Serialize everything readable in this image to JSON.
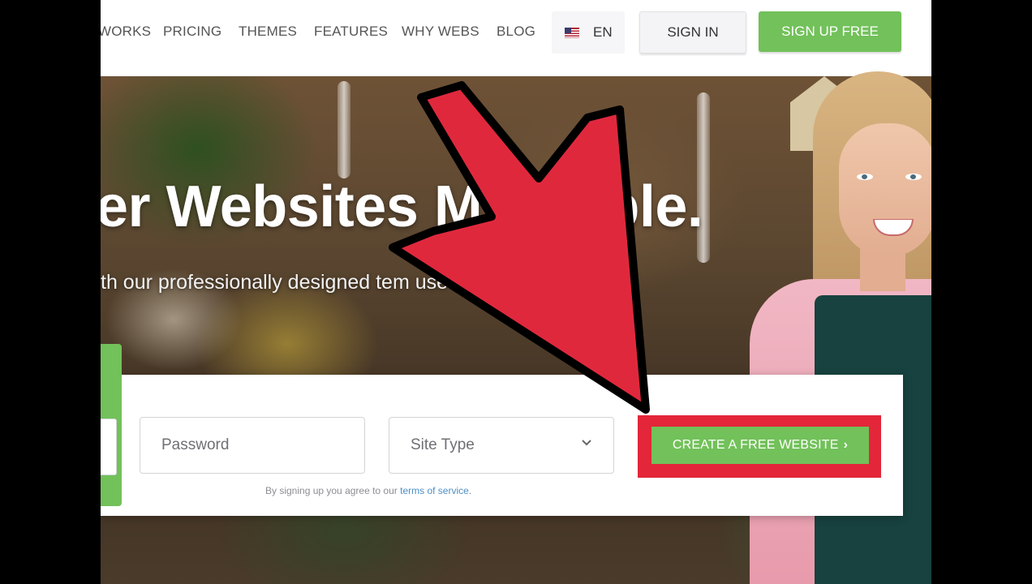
{
  "nav": {
    "links": [
      "WORKS",
      "PRICING",
      "THEMES",
      "FEATURES",
      "WHY WEBS",
      "BLOG"
    ],
    "language": "EN",
    "signin_label": "SIGN IN",
    "signup_label": "SIGN UP FREE"
  },
  "hero": {
    "headline": "er Websites M    Simple.",
    "subhead": "th our professionally designed tem                            use free website builder."
  },
  "form": {
    "password_placeholder": "Password",
    "site_type_placeholder": "Site Type",
    "terms_prefix": "By signing up you agree to our ",
    "terms_link": "terms of service.",
    "cta_label": "CREATE A FREE WEBSITE"
  },
  "colors": {
    "accent_green": "#72c15a",
    "highlight_red": "#e32639"
  },
  "icons": {
    "flag": "us-flag-icon",
    "dropdown": "chevron-down-icon",
    "cta": "chevron-right-icon"
  }
}
